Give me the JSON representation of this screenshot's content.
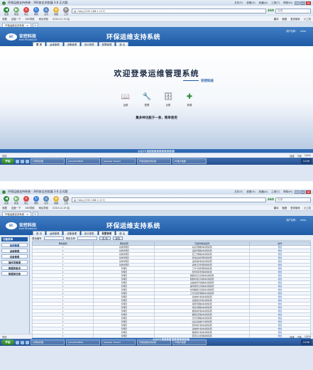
{
  "browser": {
    "title": "环保运维支持系统 - 360安全浏览器 3.6 正式版",
    "menu": [
      "文件(F)",
      "查看(V)",
      "收藏(A)",
      "工具(T)",
      "帮助(H)"
    ],
    "nav_labels": [
      "后退",
      "前进",
      "停止",
      "刷新",
      "主页",
      "收藏",
      "工具"
    ],
    "address": "http://192.168.1.117/",
    "brand": "360",
    "search_placeholder": "百度",
    "favorites": [
      "收藏",
      "百度一下",
      "360导航",
      "网址导航",
      "2010.11.19 后"
    ],
    "favorites_right": [
      "翻译",
      "截图",
      "登录管家",
      "小工具"
    ],
    "tab_label": "环保运维支持系统",
    "tab_add": "+"
  },
  "app": {
    "logo_text": "安控科技",
    "logo_sub": "ECHO TECHNOLOGY",
    "title": "环保运维支持系统",
    "user_label": "用户名称：",
    "user_name": "echo",
    "nav": [
      "首 页",
      "运维管理",
      "设备管理",
      "统计报表",
      "配置管理",
      "退 出"
    ]
  },
  "welcome": {
    "title": "欢迎登录运维管理系统",
    "subtitle": "安控科技",
    "quick": [
      {
        "label": "运维",
        "icon": "book-icon"
      },
      {
        "label": "配置",
        "icon": "tools-icon"
      },
      {
        "label": "台账",
        "icon": "cabinet-icon"
      },
      {
        "label": "新增",
        "icon": "add-document-icon"
      }
    ],
    "slogan": "集多种功能于一身，简单易用",
    "footer": "版权所有 ▌▌▌▌▌▌▌▌▌▌▌▌▌▌▌▌▌"
  },
  "status": {
    "left": "完成",
    "right": [
      "加速",
      "下载",
      "100%"
    ]
  },
  "taskbar": {
    "start": "开始",
    "items": [
      "计算机管理",
      "echo2010Mdb",
      "Speeder Tracert",
      "环保运维支持系统",
      "EP统计数据"
    ],
    "clock": "14:56"
  },
  "mgmt": {
    "side_title": "功能菜单",
    "side_items": [
      "系统管理",
      "运维管理",
      "设备管理",
      "操作员管理",
      "数据库备份",
      "数据库还原"
    ],
    "filter_label1": "角色编号",
    "filter_label2": "角色名称",
    "query_button": "查 询",
    "add_button": "添加",
    "columns": [
      "角色编码",
      "角色名称",
      "可操作模块名称",
      "操作"
    ],
    "rows": [
      [
        "1",
        "系统管理员",
        "站点管理模块功能权限",
        "修改"
      ],
      [
        "1",
        "系统管理员",
        "设备管理模块功能权限",
        "修改"
      ],
      [
        "1",
        "系统管理员",
        "员工管理模块功能权限",
        "修改"
      ],
      [
        "1",
        "系统管理员",
        "区域设备管理功能权限",
        "修改"
      ],
      [
        "1",
        "系统管理员",
        "设备维护模块功能权限",
        "修改"
      ],
      [
        "1",
        "系统管理员",
        "运维记录管理功能权限",
        "修改"
      ],
      [
        "1",
        "管理员",
        "工作计划管理功能权限",
        "修改"
      ],
      [
        "1",
        "管理员",
        "配件库存管理功能权限",
        "修改"
      ],
      [
        "1",
        "管理员",
        "数据标定记录模块功能权限",
        "修改"
      ],
      [
        "1",
        "管理员",
        "数据标准记录模块功能权限",
        "修改"
      ],
      [
        "1",
        "管理员",
        "设备故障查询模块功能权限",
        "修改"
      ],
      [
        "1",
        "管理员",
        "故障维修记录模块功能权限",
        "修改"
      ],
      [
        "1",
        "管理员",
        "检测数据记录模块功能权限",
        "修改"
      ],
      [
        "1",
        "管理员",
        "工作日报管理模块功能权限",
        "修改"
      ],
      [
        "1",
        "管理员",
        "系统统计模块功能权限",
        "修改"
      ],
      [
        "1",
        "管理员",
        "运维报表查看功能权限",
        "修改"
      ],
      [
        "1",
        "管理员",
        "权限管理模块功能权限",
        "修改"
      ],
      [
        "1",
        "管理员",
        "角色管理模块功能权限",
        "修改"
      ],
      [
        "1",
        "管理员",
        "数据备份模块功能权限",
        "修改"
      ],
      [
        "1",
        "管理员",
        "数据还原模块功能权限",
        "修改"
      ],
      [
        "1",
        "管理员",
        "日志管理模块功能权限",
        "修改"
      ],
      [
        "1",
        "管理员",
        "站点设备统计功能权限",
        "修改"
      ],
      [
        "1",
        "管理员",
        "配件统计模块功能权限",
        "修改"
      ],
      [
        "1",
        "管理员",
        "运维统计模块功能权限",
        "修改"
      ],
      [
        "1",
        "管理员",
        "数据统计模块功能权限",
        "修改"
      ],
      [
        "1",
        "管理员",
        "首页信息管理功能权限",
        "修改"
      ]
    ],
    "footer": "版权所有 ▌▌▌▌▌▌▌▌▌▌▌▌▌▌▌▌▌"
  }
}
